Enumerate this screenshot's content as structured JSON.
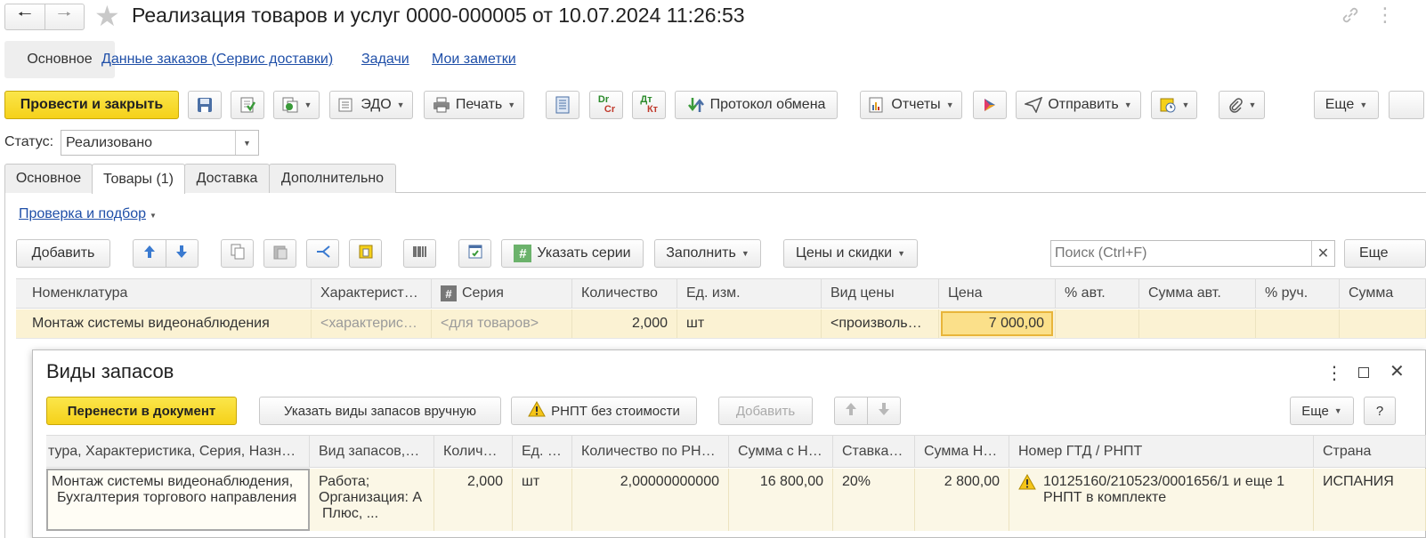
{
  "window": {
    "title": "Реализация товаров и услуг 0000-000005 от 10.07.2024 11:26:53"
  },
  "nav_links": {
    "main": "Основное",
    "orders": "Данные заказов (Сервис доставки)",
    "tasks": "Задачи",
    "notes": "Мои заметки"
  },
  "toolbar": {
    "post_close": "Провести и закрыть",
    "edo": "ЭДО",
    "print": "Печать",
    "dr": "Dr",
    "cr": "Cr",
    "dt": "Дт",
    "kt": "Кт",
    "exchange_protocol": "Протокол обмена",
    "reports": "Отчеты",
    "send": "Отправить",
    "more": "Еще"
  },
  "status": {
    "label": "Статус:",
    "value": "Реализовано"
  },
  "tabs": [
    "Основное",
    "Товары (1)",
    "Доставка",
    "Дополнительно"
  ],
  "goods": {
    "check_link": "Проверка и подбор",
    "add": "Добавить",
    "set_series": "Указать серии",
    "fill": "Заполнить",
    "prices": "Цены и скидки",
    "search_placeholder": "Поиск (Ctrl+F)",
    "more": "Еще",
    "columns": [
      "Номенклатура",
      "Характерист…",
      "Серия",
      "Количество",
      "Ед. изм.",
      "Вид цены",
      "Цена",
      "% авт.",
      "Сумма авт.",
      "% руч.",
      "Сумма"
    ],
    "row": {
      "item": "Монтаж системы видеонаблюдения",
      "characteristic": "<характерис…",
      "series": "<для товаров>",
      "quantity": "2,000",
      "unit": "шт",
      "price_kind": "<произволь…",
      "price": "7 000,00"
    }
  },
  "dialog": {
    "title": "Виды запасов",
    "transfer": "Перенести в документ",
    "manual": "Указать виды запасов вручную",
    "rnpt": "РНПТ без стоимости",
    "add": "Добавить",
    "more": "Еще",
    "help": "?",
    "columns": [
      "тура, Характеристика, Серия, Назн…",
      "Вид запасов,…",
      "Колич…",
      "Ед. …",
      "Количество по РН…",
      "Сумма с Н…",
      "Ставка…",
      "Сумма Н…",
      "Номер ГТД / РНПТ",
      "Страна"
    ],
    "row": {
      "item_line1": "Монтаж системы видеонаблюдения,",
      "item_line2": "Бухгалтерия торгового направления",
      "stock_line1": "Работа;",
      "stock_line2": "Организация: А",
      "stock_line3": "Плюс, ...",
      "quantity": "2,000",
      "unit": "шт",
      "rnpt_qty": "2,00000000000",
      "sum_vat": "16 800,00",
      "rate": "20%",
      "vat": "2 800,00",
      "gtd_line1": "10125160/210523/0001656/1 и еще 1",
      "gtd_line2": "РНПТ в комплекте",
      "country": "ИСПАНИЯ"
    }
  }
}
